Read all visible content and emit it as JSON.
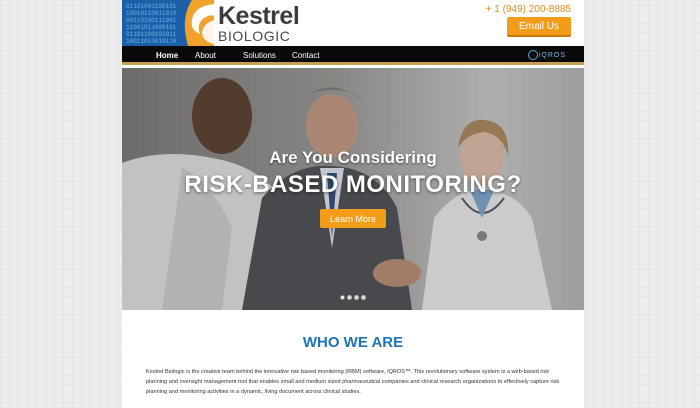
{
  "brand": {
    "name_line1": "Kestrel",
    "name_line2": "BIOLOGIC",
    "colors": {
      "accent": "#f39c1a",
      "title_blue": "#1f73b7",
      "nav_bg": "#0a0a0a"
    }
  },
  "header": {
    "phone": "+ 1 (949) 200-8885",
    "email_button": "Email Us"
  },
  "nav": {
    "items": [
      {
        "label": "Home",
        "active": true
      },
      {
        "label": "About Us",
        "active": false
      },
      {
        "label": "Solutions",
        "active": false
      },
      {
        "label": "Contact Us",
        "active": false
      }
    ],
    "product_logo": "iQROS"
  },
  "hero": {
    "line1": "Are You Considering",
    "line2": "RISK-BASED MONITORING?",
    "button": "Learn More",
    "slides": 4,
    "active_slide": 1
  },
  "who": {
    "title": "WHO WE ARE",
    "text": "Kestrel Biologic is the creative team behind the innovative risk based monitoring (RBM) software, iQROS™. This revolutionary software system is a web-based risk planning and oversight management tool that enables small and medium sized pharmaceutical companies and clinical research organizations to effectively capture risk planning and monitoring activities in a dynamic, living document across clinical studies."
  }
}
